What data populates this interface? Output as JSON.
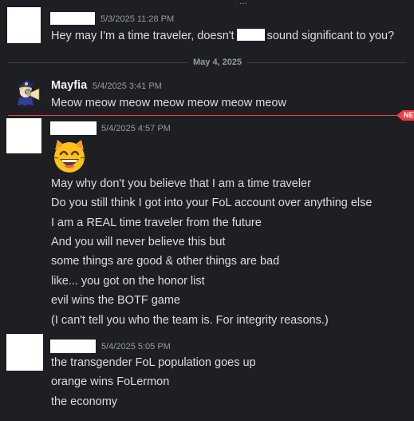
{
  "top_clip": "...",
  "messages": [
    {
      "timestamp": "5/3/2025 11:28 PM",
      "line_before": "Hey may I'm a time traveler, doesn't",
      "line_after": "sound significant to you?"
    },
    {
      "date_divider": "May 4, 2025"
    },
    {
      "username": "Mayfia",
      "timestamp": "5/4/2025 3:41 PM",
      "text": "Meow meow meow meow meow meow meow"
    },
    {
      "new_badge": "NEW",
      "timestamp": "5/4/2025 4:57 PM",
      "emoji": "grinning-cat-emoji",
      "lines": [
        "May why don't you believe that I am a time traveler",
        "Do you still think I got into your FoL account over anything else",
        "I am a REAL time traveler from the future",
        "And you will never believe this but",
        "some things are good & other things are bad",
        "like... you got on the honor list",
        "evil wins the BOTF game",
        "(I can't tell you who the team is. For integrity reasons.)"
      ]
    },
    {
      "timestamp": "5/4/2025 5:05 PM",
      "lines": [
        "the transgender FoL population goes up",
        "orange wins FoLermon",
        "the economy"
      ]
    }
  ],
  "colors": {
    "background": "#1e1f22",
    "text": "#dbdee1",
    "muted": "#949ba4",
    "new_red": "#f23f43"
  }
}
